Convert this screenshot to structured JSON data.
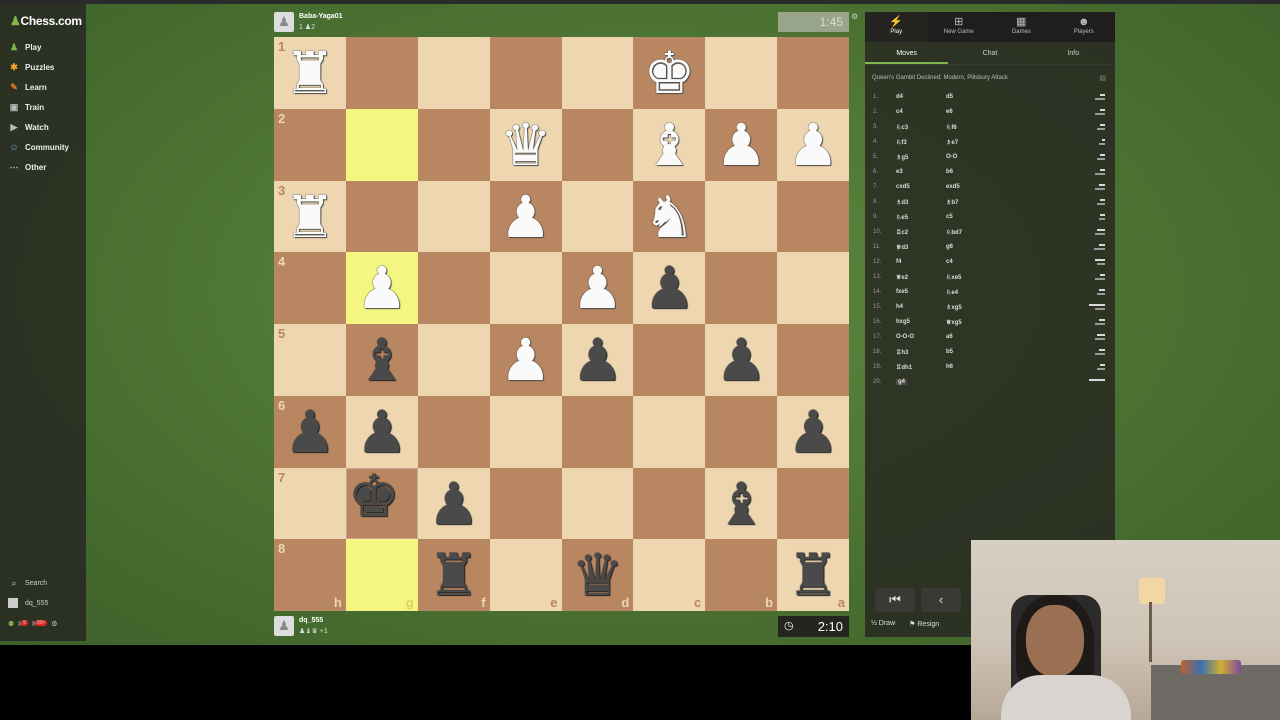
{
  "sidebar": {
    "logo": "Chess.com",
    "items": [
      {
        "label": "Play",
        "icon": "play-icon"
      },
      {
        "label": "Puzzles",
        "icon": "puzzle-icon"
      },
      {
        "label": "Learn",
        "icon": "learn-icon"
      },
      {
        "label": "Train",
        "icon": "train-icon"
      },
      {
        "label": "Watch",
        "icon": "watch-icon"
      },
      {
        "label": "Community",
        "icon": "community-icon"
      },
      {
        "label": "Other",
        "icon": "other-icon"
      }
    ],
    "search_label": "Search",
    "user_label": "dq_555",
    "notif_badge_1": "9",
    "notif_badge_2": "99+"
  },
  "top_player": {
    "name": "Baba-Yaga01",
    "captured": "1 ♟2"
  },
  "bottom_player": {
    "name": "dq_555",
    "captured": "♟♝♛ +1"
  },
  "clocks": {
    "top": "1:45",
    "bottom": "2:10"
  },
  "board": {
    "rank_labels": [
      "1",
      "2",
      "3",
      "4",
      "5",
      "6",
      "7",
      "8"
    ],
    "file_labels": [
      "h",
      "g",
      "f",
      "e",
      "d",
      "c",
      "b",
      "a"
    ],
    "squares": [
      [
        "wR",
        "",
        "",
        "",
        "",
        "wK",
        "",
        ""
      ],
      [
        "",
        "",
        "",
        "wQ",
        "",
        "wB",
        "wP",
        "wP"
      ],
      [
        "wR",
        "",
        "",
        "wP",
        "",
        "wN",
        "",
        ""
      ],
      [
        "",
        "wP",
        "",
        "",
        "wP",
        "bP",
        "",
        ""
      ],
      [
        "",
        "bB",
        "",
        "wP",
        "bP",
        "",
        "bP",
        ""
      ],
      [
        "bP",
        "bP",
        "",
        "",
        "",
        "",
        "",
        "bP"
      ],
      [
        "",
        "bK",
        "bP",
        "",
        "",
        "",
        "bB",
        ""
      ],
      [
        "",
        "",
        "bR",
        "",
        "bQ",
        "",
        "",
        "bR"
      ]
    ],
    "highlighted": [
      [
        1,
        1
      ],
      [
        3,
        1
      ],
      [
        7,
        1
      ]
    ],
    "ring": [
      [
        6,
        1
      ]
    ],
    "dragged": [
      [
        6,
        1
      ]
    ]
  },
  "panel": {
    "tabs": [
      {
        "label": "Play",
        "icon": "play-tab-icon"
      },
      {
        "label": "New Game",
        "icon": "new-game-icon"
      },
      {
        "label": "Games",
        "icon": "games-icon"
      },
      {
        "label": "Players",
        "icon": "players-icon"
      }
    ],
    "subtabs": [
      "Moves",
      "Chat",
      "Info"
    ],
    "opening": "Queen's Gambit Declined: Modern, Pillsbury Attack",
    "moves": [
      {
        "n": "1.",
        "w": "d4",
        "b": "d5",
        "t": [
          0.3,
          0.6
        ]
      },
      {
        "n": "2.",
        "w": "c4",
        "b": "e6",
        "t": [
          0.3,
          0.6
        ]
      },
      {
        "n": "3.",
        "w": "♘c3",
        "b": "♘f6",
        "t": [
          0.3,
          0.5
        ]
      },
      {
        "n": "4.",
        "w": "♘f3",
        "b": "♗e7",
        "t": [
          0.2,
          0.4
        ]
      },
      {
        "n": "5.",
        "w": "♗g5",
        "b": "O-O",
        "t": [
          0.3,
          0.5
        ]
      },
      {
        "n": "6.",
        "w": "e3",
        "b": "b6",
        "t": [
          0.3,
          0.6
        ]
      },
      {
        "n": "7.",
        "w": "cxd5",
        "b": "exd5",
        "t": [
          0.4,
          0.6
        ]
      },
      {
        "n": "8.",
        "w": "♗d3",
        "b": "♗b7",
        "t": [
          0.3,
          0.5
        ]
      },
      {
        "n": "9.",
        "w": "♘e5",
        "b": "c5",
        "t": [
          0.3,
          0.4
        ]
      },
      {
        "n": "10.",
        "w": "♖c2",
        "b": "♘bd7",
        "t": [
          0.5,
          0.6
        ]
      },
      {
        "n": "11.",
        "w": "♕d3",
        "b": "g6",
        "t": [
          0.4,
          0.7
        ]
      },
      {
        "n": "12.",
        "w": "f4",
        "b": "c4",
        "t": [
          0.6,
          0.5
        ]
      },
      {
        "n": "13.",
        "w": "♕e2",
        "b": "♘xe5",
        "t": [
          0.3,
          0.6
        ]
      },
      {
        "n": "14.",
        "w": "fxe5",
        "b": "♘e4",
        "t": [
          0.4,
          0.5
        ]
      },
      {
        "n": "15.",
        "w": "h4",
        "b": "♗xg5",
        "t": [
          1.0,
          0.6
        ]
      },
      {
        "n": "16.",
        "w": "hxg5",
        "b": "♕xg5",
        "t": [
          0.4,
          0.6
        ]
      },
      {
        "n": "17.",
        "w": "O-O-O",
        "b": "a6",
        "t": [
          0.5,
          0.6
        ]
      },
      {
        "n": "18.",
        "w": "♖h3",
        "b": "b5",
        "t": [
          0.4,
          0.6
        ]
      },
      {
        "n": "19.",
        "w": "♖dh1",
        "b": "h6",
        "t": [
          0.3,
          0.5
        ]
      },
      {
        "n": "20.",
        "w": "g4",
        "b": "",
        "t": [
          1.0,
          0
        ]
      }
    ],
    "draw_label": "Draw",
    "resign_label": "Resign",
    "draw_prefix": "½"
  }
}
